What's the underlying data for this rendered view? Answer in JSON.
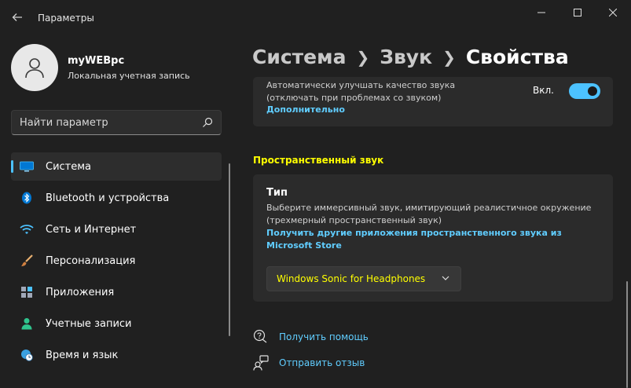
{
  "window": {
    "title": "Параметры"
  },
  "user": {
    "name": "myWEBpc",
    "account_type": "Локальная учетная запись"
  },
  "search": {
    "placeholder": "Найти параметр"
  },
  "nav": {
    "items": [
      {
        "label": "Система",
        "icon": "display-icon",
        "active": true
      },
      {
        "label": "Bluetooth и устройства",
        "icon": "bluetooth-icon"
      },
      {
        "label": "Сеть и Интернет",
        "icon": "wifi-icon"
      },
      {
        "label": "Персонализация",
        "icon": "brush-icon"
      },
      {
        "label": "Приложения",
        "icon": "apps-icon"
      },
      {
        "label": "Учетные записи",
        "icon": "person-icon"
      },
      {
        "label": "Время и язык",
        "icon": "globe-clock-icon"
      }
    ]
  },
  "breadcrumb": {
    "items": [
      "Система",
      "Звук",
      "Свойства"
    ]
  },
  "enhance": {
    "line1": "Автоматически улучшать качество звука",
    "line2": "(отключать при проблемах со звуком)",
    "link": "Дополнительно",
    "toggle_label": "Вкл.",
    "toggle_on": true
  },
  "spatial": {
    "section_title": "Пространственный звук",
    "card_title": "Тип",
    "description": "Выберите иммерсивный звук, имитирующий реалистичное окружение (трехмерный пространственный звук)",
    "link": "Получить другие приложения пространственного звука из Microsoft Store",
    "selected": "Windows Sonic for Headphones"
  },
  "help": {
    "get_help": "Получить помощь",
    "feedback": "Отправить отзыв"
  },
  "colors": {
    "background": "#202020",
    "card": "#2b2b2b",
    "accent": "#4cc2ff",
    "link": "#60cdff",
    "highlight": "#ffff00"
  }
}
